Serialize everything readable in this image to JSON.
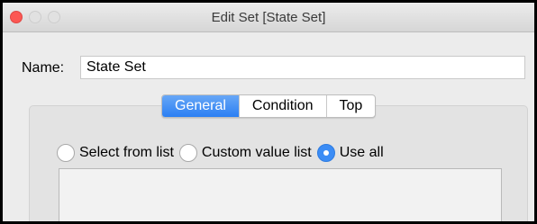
{
  "window": {
    "title": "Edit Set [State Set]"
  },
  "name_field": {
    "label": "Name:",
    "value": "State Set"
  },
  "tabs": [
    {
      "label": "General",
      "selected": true
    },
    {
      "label": "Condition",
      "selected": false
    },
    {
      "label": "Top",
      "selected": false
    }
  ],
  "radio_options": [
    {
      "label": "Select from list",
      "checked": false
    },
    {
      "label": "Custom value list",
      "checked": false
    },
    {
      "label": "Use all",
      "checked": true
    }
  ],
  "colors": {
    "accent": "#3b8cf5",
    "close_button": "#fc5753",
    "window_bg": "#ececec",
    "panel_bg": "#e3e3e3"
  }
}
